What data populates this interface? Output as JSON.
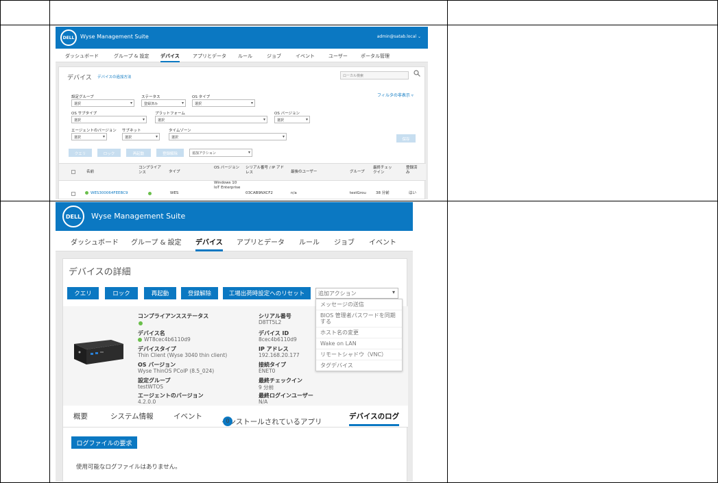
{
  "screenshot1": {
    "brand": "Wyse Management Suite",
    "logo": "DELL",
    "user": "admin@satab.local ⌄",
    "nav": [
      "ダッシュボード",
      "グループ & 設定",
      "デバイス",
      "アプリとデータ",
      "ルール",
      "ジョブ",
      "イベント",
      "ユーザー",
      "ポータル管理"
    ],
    "nav_active_index": 2,
    "title": "デバイス",
    "howto": "デバイスの追加方法",
    "search_placeholder": "ローカル検索",
    "filter_link": "フィルタの非表示 ▿",
    "filters": {
      "config_group": {
        "label": "設定グループ",
        "value": "選択"
      },
      "status": {
        "label": "ステータス",
        "value": "登録済み"
      },
      "os_type": {
        "label": "OS タイプ",
        "value": "選択"
      },
      "os_subtype": {
        "label": "OS サブタイプ",
        "value": "選択"
      },
      "platform": {
        "label": "プラットフォーム",
        "value": "選択"
      },
      "os_version": {
        "label": "OS バージョン",
        "value": "選択"
      },
      "agent_version": {
        "label": "エージェントのバージョン",
        "value": "選択"
      },
      "subnet": {
        "label": "サブネット",
        "value": "選択"
      },
      "timezone": {
        "label": "タイムゾーン",
        "value": "選択"
      },
      "save_button": "保存"
    },
    "actions": [
      "クエリ",
      "ロック",
      "再起動",
      "登録解除"
    ],
    "more_actions": "追加アクション",
    "table_headers": [
      "名前",
      "コンプライアンス",
      "タイプ",
      "OS バージョン",
      "シリアル番号 / IP アドレス",
      "最後のユーザー",
      "グループ",
      "最終チェックイン",
      "登録済み"
    ],
    "row": {
      "name": "WES300064FEEBC9",
      "type": "WES",
      "os_version": "Windows 10 IoT Enterprise",
      "serial": "03CAB9NXCF2",
      "last_user": "n/a",
      "group": "testGrou",
      "checkin": "38 分前",
      "registered": "はい"
    }
  },
  "screenshot2": {
    "brand": "Wyse Management Suite",
    "logo": "DELL",
    "nav": [
      "ダッシュボード",
      "グループ & 設定",
      "デバイス",
      "アプリとデータ",
      "ルール",
      "ジョブ",
      "イベント"
    ],
    "nav_active_index": 2,
    "title": "デバイスの詳細",
    "buttons": [
      "クエリ",
      "ロック",
      "再起動",
      "登録解除",
      "工場出荷時設定へのリセット"
    ],
    "more_actions": "追加アクション",
    "menu_items": [
      "メッセージの送信",
      "BIOS 管理者パスワードを同期する",
      "ホスト名の変更",
      "Wake on LAN",
      "リモートシャドウ（VNC）",
      "タグデバイス"
    ],
    "info": {
      "compliance_label": "コンプライアンスステータス",
      "device_name_label": "デバイス名",
      "device_name": "WT8cec4b6110d9",
      "device_type_label": "デバイスタイプ",
      "device_type": "Thin Client (Wyse 3040 thin client)",
      "os_version_label": "OS バージョン",
      "os_version": "Wyse ThinOS PCoIP (8.5_024)",
      "config_group_label": "設定グループ",
      "config_group": "testWTOS",
      "agent_version_label": "エージェントのバージョン",
      "agent_version": "4.2.0.0",
      "serial_label": "シリアル番号",
      "serial": "D8TT5L2",
      "device_id_label": "デバイス ID",
      "device_id": "8cec4b6110d9",
      "ip_label": "IP アドレス",
      "ip": "192.168.20.177",
      "connection_label": "接続タイプ",
      "connection": "ENET0",
      "last_checkin_label": "最終チェックイン",
      "last_checkin": "9 分前",
      "last_login_label": "最終ログインユーザー",
      "last_login": "N/A"
    },
    "tabs": [
      "概要",
      "システム情報",
      "イベント",
      "インストールされているアプリ",
      "デバイスのログ"
    ],
    "installed_apps_count": "0",
    "log_request_button": "ログファイルの要求",
    "no_logs": "使用可能なログファイルはありません。"
  },
  "colors": {
    "brand_blue": "#0b78c2",
    "status_green": "#6abf4b"
  }
}
